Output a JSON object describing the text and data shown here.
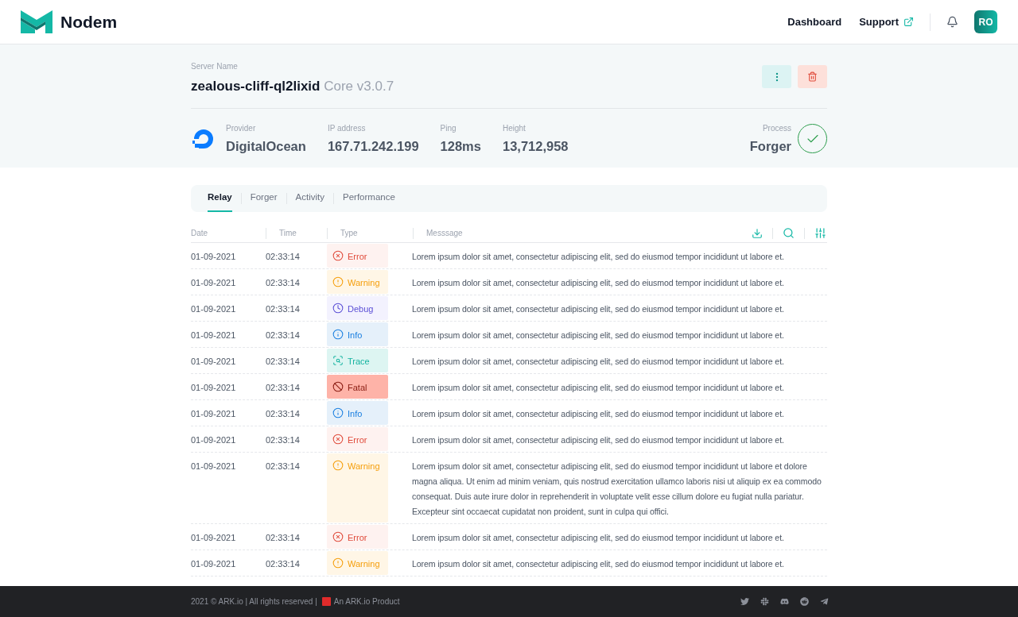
{
  "brand": "Nodem",
  "nav": [
    {
      "label": "Dashboard",
      "external": false
    },
    {
      "label": "Support",
      "external": true
    }
  ],
  "avatar": "RO",
  "server": {
    "label": "Server Name",
    "name": "zealous-cliff-ql2lixid",
    "version": "Core v3.0.7"
  },
  "stats": [
    {
      "label": "Provider",
      "value": "DigitalOcean"
    },
    {
      "label": "IP address",
      "value": "167.71.242.199"
    },
    {
      "label": "Ping",
      "value": "128ms"
    },
    {
      "label": "Height",
      "value": "13,712,958"
    }
  ],
  "process": {
    "label": "Process",
    "value": "Forger",
    "ok": true
  },
  "tabs": [
    {
      "label": "Relay",
      "selected": true
    },
    {
      "label": "Forger",
      "selected": false
    },
    {
      "label": "Activity",
      "selected": false
    },
    {
      "label": "Performance",
      "selected": false
    }
  ],
  "table": {
    "columns": [
      "Date",
      "Time",
      "Type",
      "Messsage"
    ],
    "rows": [
      {
        "date": "01-09-2021",
        "time": "02:33:14",
        "kind": "error",
        "type": "Error",
        "message": "Lorem ipsum dolor sit amet, consectetur adipiscing elit, sed do eiusmod tempor incididunt ut labore et."
      },
      {
        "date": "01-09-2021",
        "time": "02:33:14",
        "kind": "warning",
        "type": "Warning",
        "message": "Lorem ipsum dolor sit amet, consectetur adipiscing elit, sed do eiusmod tempor incididunt ut labore et."
      },
      {
        "date": "01-09-2021",
        "time": "02:33:14",
        "kind": "debug",
        "type": "Debug",
        "message": "Lorem ipsum dolor sit amet, consectetur adipiscing elit, sed do eiusmod tempor incididunt ut labore et."
      },
      {
        "date": "01-09-2021",
        "time": "02:33:14",
        "kind": "info",
        "type": "Info",
        "message": "Lorem ipsum dolor sit amet, consectetur adipiscing elit, sed do eiusmod tempor incididunt ut labore et."
      },
      {
        "date": "01-09-2021",
        "time": "02:33:14",
        "kind": "trace",
        "type": "Trace",
        "message": "Lorem ipsum dolor sit amet, consectetur adipiscing elit, sed do eiusmod tempor incididunt ut labore et."
      },
      {
        "date": "01-09-2021",
        "time": "02:33:14",
        "kind": "fatal",
        "type": "Fatal",
        "message": "Lorem ipsum dolor sit amet, consectetur adipiscing elit, sed do eiusmod tempor incididunt ut labore et."
      },
      {
        "date": "01-09-2021",
        "time": "02:33:14",
        "kind": "info",
        "type": "Info",
        "message": "Lorem ipsum dolor sit amet, consectetur adipiscing elit, sed do eiusmod tempor incididunt ut labore et."
      },
      {
        "date": "01-09-2021",
        "time": "02:33:14",
        "kind": "error",
        "type": "Error",
        "message": "Lorem ipsum dolor sit amet, consectetur adipiscing elit, sed do eiusmod tempor incididunt ut labore et."
      },
      {
        "date": "01-09-2021",
        "time": "02:33:14",
        "kind": "warning",
        "type": "Warning",
        "message": "Lorem ipsum dolor sit amet, consectetur adipiscing elit, sed do eiusmod tempor incididunt ut labore et dolore magna aliqua. Ut enim ad minim veniam, quis nostrud exercitation ullamco laboris nisi ut aliquip ex ea commodo consequat. Duis aute irure dolor in reprehenderit in voluptate velit esse cillum dolore eu fugiat nulla pariatur. Excepteur sint occaecat cupidatat non proident, sunt in culpa qui offici."
      },
      {
        "date": "01-09-2021",
        "time": "02:33:14",
        "kind": "error",
        "type": "Error",
        "message": "Lorem ipsum dolor sit amet, consectetur adipiscing elit, sed do eiusmod tempor incididunt ut labore et."
      },
      {
        "date": "01-09-2021",
        "time": "02:33:14",
        "kind": "warning",
        "type": "Warning",
        "message": "Lorem ipsum dolor sit amet, consectetur adipiscing elit, sed do eiusmod tempor incididunt ut labore et."
      }
    ]
  },
  "footer": {
    "copyright": "2021 © ARK.io | All rights reserved |",
    "product": "An ARK.io Product"
  }
}
